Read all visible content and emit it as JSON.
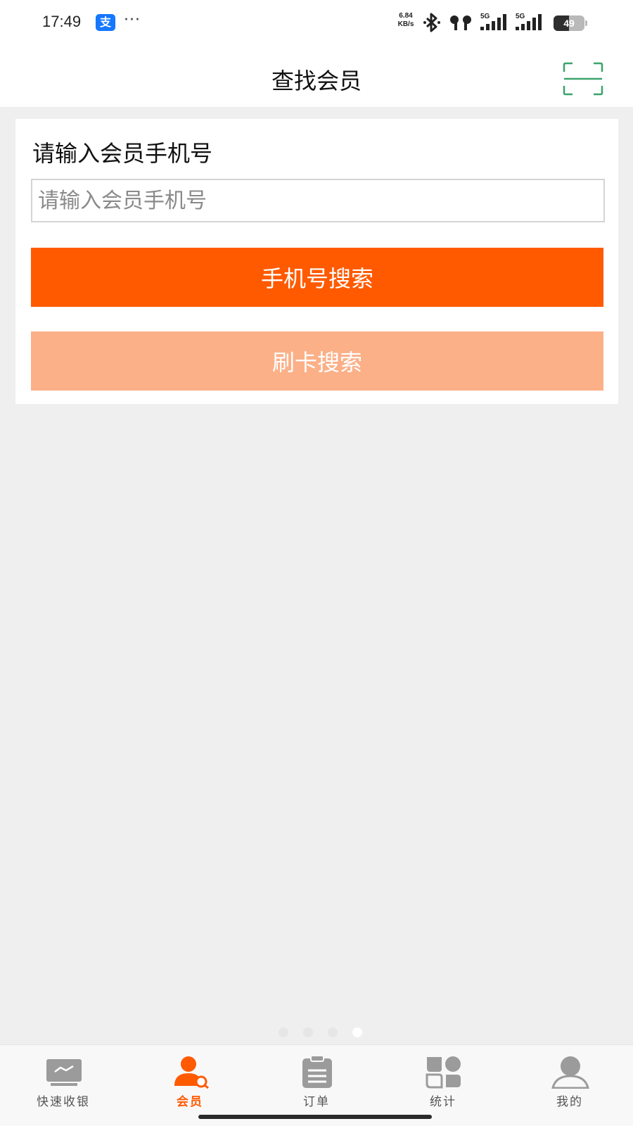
{
  "status_bar": {
    "time": "17:49",
    "alipay_glyph": "支",
    "more": "···",
    "net_speed_value": "6.84",
    "net_speed_unit": "KB/s",
    "signal_1_label": "5G",
    "signal_2_label": "5G",
    "battery_level": "49"
  },
  "header": {
    "title": "查找会员",
    "scan_icon": "scan-icon",
    "accent_color": "#3aa36a"
  },
  "card": {
    "label": "请输入会员手机号",
    "input_placeholder": "请输入会员手机号",
    "input_value": "",
    "phone_search_button": "手机号搜索",
    "card_search_button": "刷卡搜索"
  },
  "colors": {
    "primary": "#ff5a00",
    "primary_light": "#fbb088",
    "background": "#efefef"
  },
  "page_dots": {
    "count": 4,
    "active_index": 3
  },
  "bottom_nav": {
    "items": [
      {
        "label": "快速收银",
        "icon": "cashier-monitor-icon",
        "active": false
      },
      {
        "label": "会员",
        "icon": "member-search-icon",
        "active": true
      },
      {
        "label": "订单",
        "icon": "clipboard-icon",
        "active": false
      },
      {
        "label": "统计",
        "icon": "stats-grid-icon",
        "active": false
      },
      {
        "label": "我的",
        "icon": "profile-icon",
        "active": false
      }
    ]
  }
}
